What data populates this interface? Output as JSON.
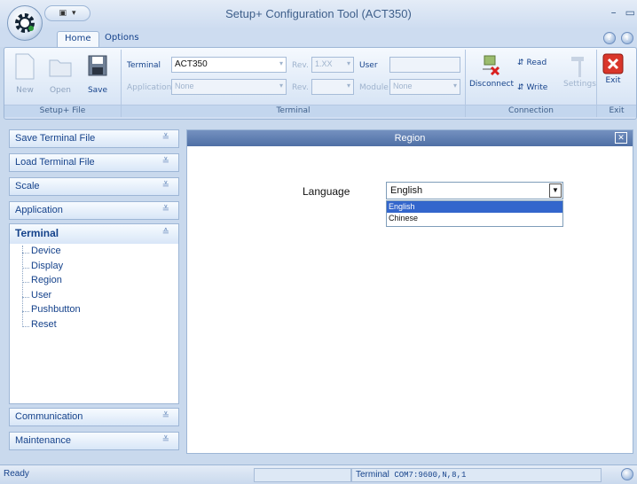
{
  "window": {
    "title": "Setup+ Configuration Tool (ACT350)"
  },
  "tabs": [
    {
      "label": "Home"
    },
    {
      "label": "Options"
    }
  ],
  "ribbon": {
    "setup_file": {
      "label": "Setup+ File",
      "new": "New",
      "open": "Open",
      "save": "Save"
    },
    "terminal": {
      "label": "Terminal",
      "terminal_label": "Terminal",
      "terminal_value": "ACT350",
      "rev1_label": "Rev.",
      "rev1_value": "1.XX",
      "user_label": "User",
      "user_value": "",
      "application_label": "Application",
      "application_value": "None",
      "rev2_label": "Rev.",
      "rev2_value": "",
      "module_label": "Module",
      "module_value": "None"
    },
    "connection": {
      "label": "Connection",
      "disconnect": "Disconnect",
      "read": "Read",
      "write": "Write",
      "settings": "Settings"
    },
    "exit": {
      "label": "Exit",
      "button": "Exit"
    }
  },
  "sidebar": {
    "sections": [
      {
        "label": "Save Terminal File"
      },
      {
        "label": "Load Terminal File"
      },
      {
        "label": "Scale"
      },
      {
        "label": "Application"
      }
    ],
    "terminal": {
      "label": "Terminal",
      "items": [
        "Device",
        "Display",
        "Region",
        "User",
        "Pushbutton",
        "Reset"
      ]
    },
    "bottom_sections": [
      {
        "label": "Communication"
      },
      {
        "label": "Maintenance"
      }
    ]
  },
  "main": {
    "header": "Region",
    "language_label": "Language",
    "language_value": "English",
    "options": [
      "English",
      "Chinese"
    ]
  },
  "status": {
    "ready": "Ready",
    "terminal_label": "Terminal",
    "port": "COM7:9600,N,8,1"
  },
  "colors": {
    "accent": "#15428b",
    "header_bar": "#5b7bb0",
    "selection": "#3366cc"
  }
}
